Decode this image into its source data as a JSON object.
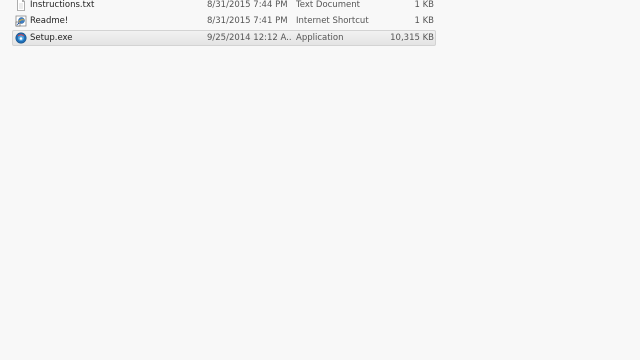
{
  "files": [
    {
      "name": "Instructions.txt",
      "date_modified": "8/31/2015 7:44 PM",
      "type": "Text Document",
      "size": "1 KB",
      "icon": "text-document-icon",
      "selected": false
    },
    {
      "name": "Readme!",
      "date_modified": "8/31/2015 7:41 PM",
      "type": "Internet Shortcut",
      "size": "1 KB",
      "icon": "internet-shortcut-icon",
      "selected": false
    },
    {
      "name": "Setup.exe",
      "date_modified": "9/25/2014 12:12 A...",
      "type": "Application",
      "size": "10,315 KB",
      "icon": "setup-application-icon",
      "selected": true
    }
  ]
}
